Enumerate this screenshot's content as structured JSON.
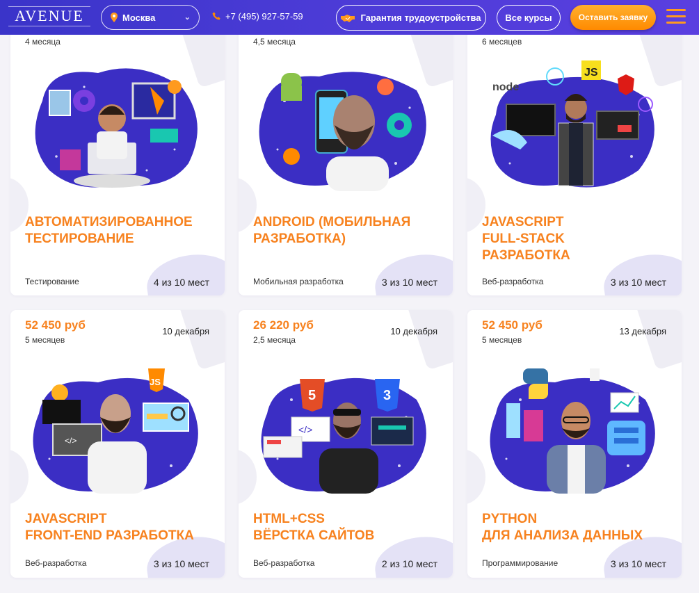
{
  "header": {
    "logo": "AVENUE",
    "city": "Москва",
    "phone": "+7 (495) 927-57-59",
    "guarantee_label": "Гарантия трудоустройства",
    "courses_label": "Все курсы",
    "apply_label": "Оставить заявку"
  },
  "courses": [
    {
      "duration": "4 месяца",
      "title_line1": "АВТОМАТИЗИРОВАННОЕ",
      "title_line2": "ТЕСТИРОВАНИЕ",
      "title_line3": "",
      "category": "Тестирование",
      "seats": "4 из 10 мест"
    },
    {
      "duration": "4,5 месяца",
      "title_line1": "ANDROID (МОБИЛЬНАЯ",
      "title_line2": "РАЗРАБОТКА)",
      "title_line3": "",
      "category": "Мобильная разработка",
      "seats": "3 из 10 мест"
    },
    {
      "duration": "6 месяцев",
      "title_line1": "JAVASCRIPT",
      "title_line2": "FULL-STACK",
      "title_line3": "РАЗРАБОТКА",
      "category": "Веб-разработка",
      "seats": "3 из 10 мест"
    },
    {
      "price": "52 450 руб",
      "duration": "5 месяцев",
      "date": "10 декабря",
      "title_line1": "JAVASCRIPT",
      "title_line2": "FRONT-END РАЗРАБОТКА",
      "category": "Веб-разработка",
      "seats": "3 из 10 мест"
    },
    {
      "price": "26 220 руб",
      "duration": "2,5 месяца",
      "date": "10 декабря",
      "title_line1": "HTML+CSS",
      "title_line2": "ВЁРСТКА САЙТОВ",
      "category": "Веб-разработка",
      "seats": "2 из 10 мест"
    },
    {
      "price": "52 450 руб",
      "duration": "5 месяцев",
      "date": "13 декабря",
      "title_line1": "PYTHON",
      "title_line2": "ДЛЯ АНАЛИЗА ДАННЫХ",
      "category": "Программирование",
      "seats": "3 из 10 мест"
    }
  ],
  "icons": {
    "css_badge": "CSS",
    "html_badge": "HTML",
    "js_badge": "JS",
    "code_tag": "</>"
  }
}
